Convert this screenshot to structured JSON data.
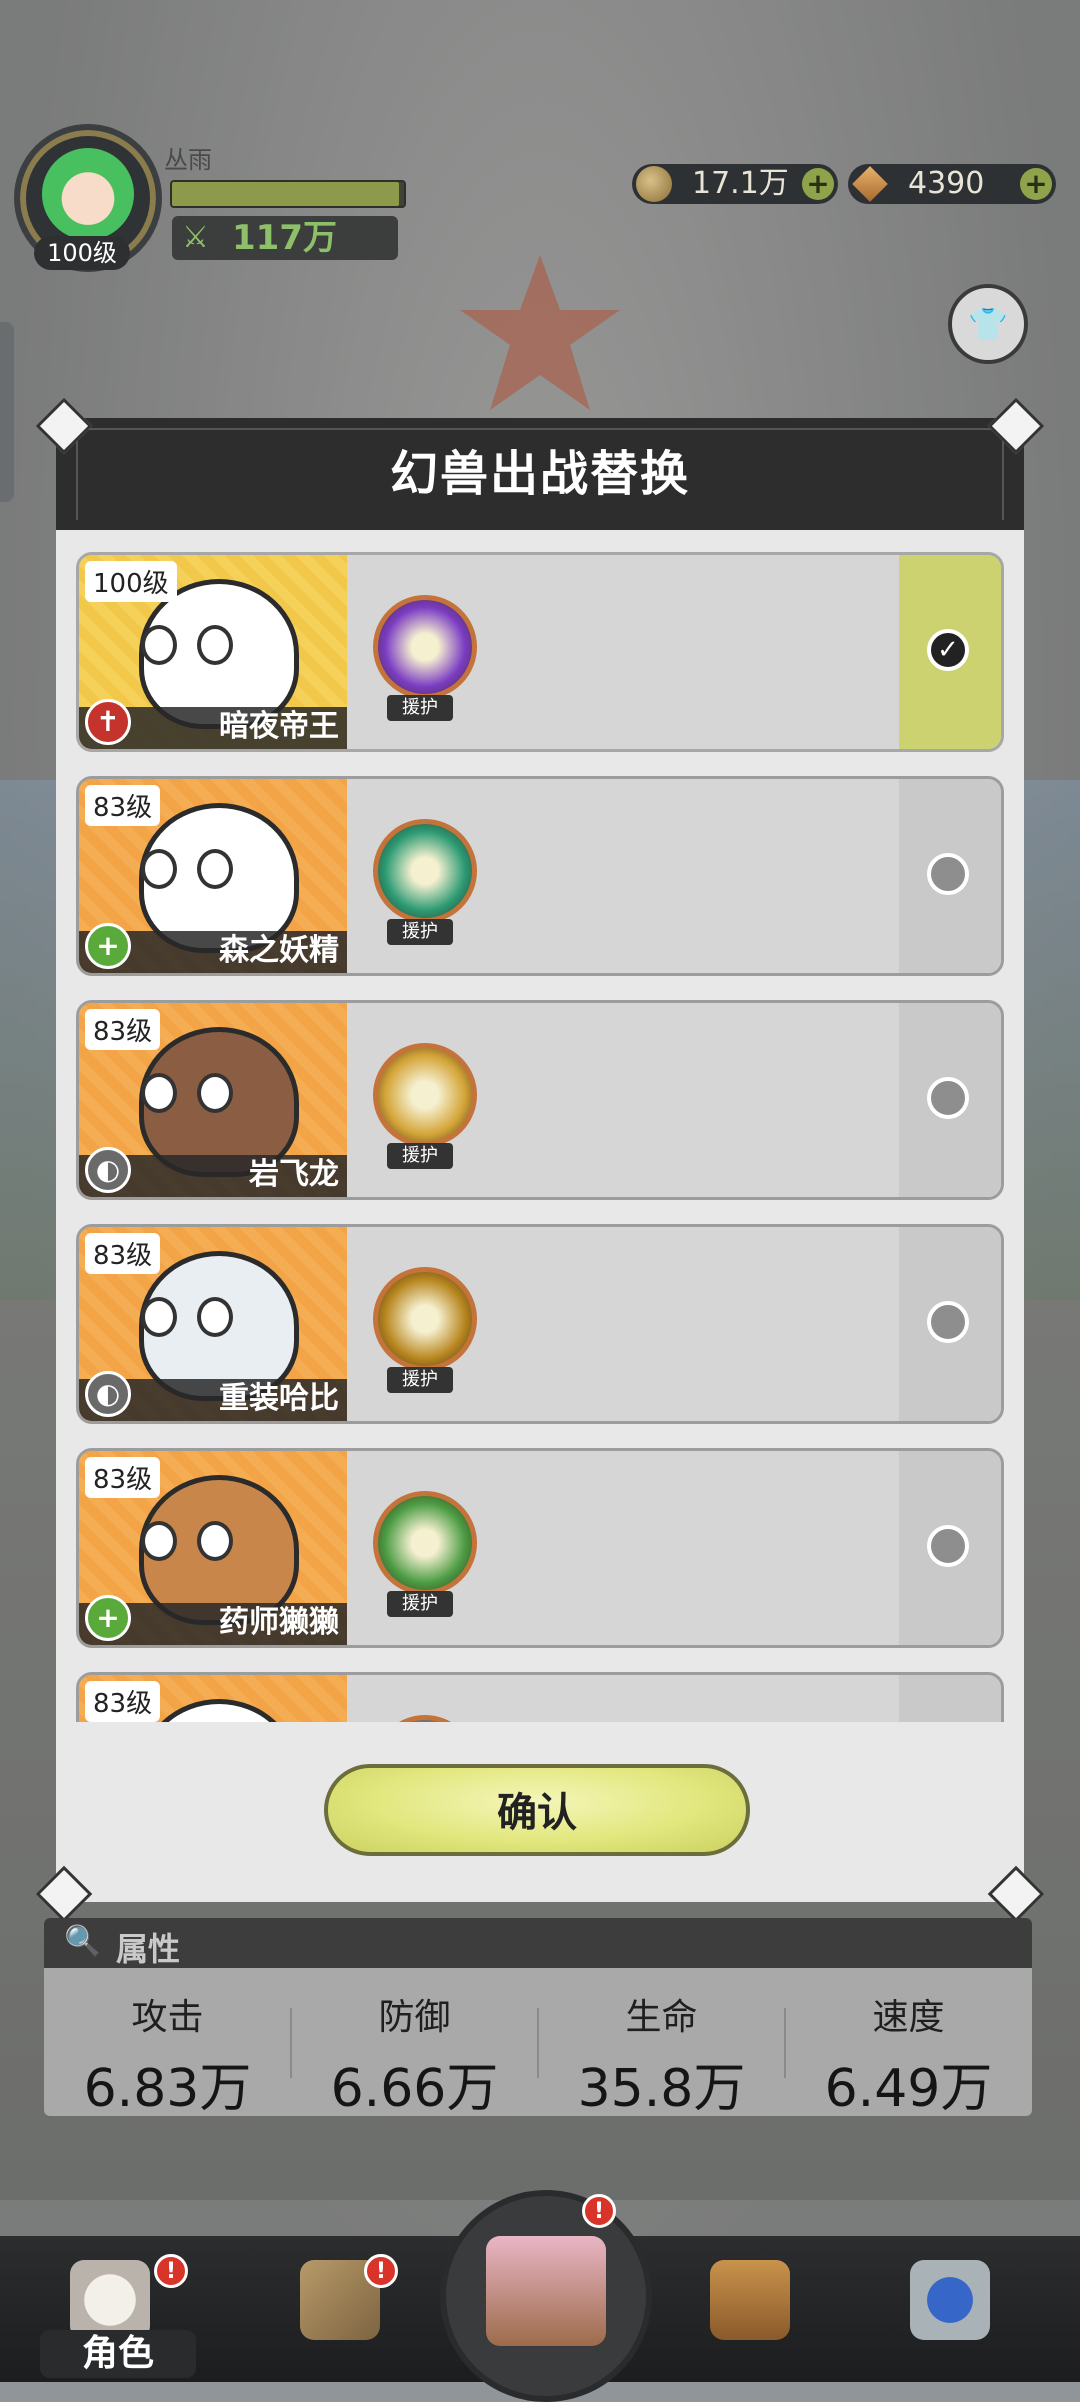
{
  "player": {
    "name": "丛雨",
    "level": "100级",
    "xp_fraction": 0.98,
    "power": "117万"
  },
  "currencies": {
    "coins": "17.1万",
    "gems": "4390",
    "plus": "+"
  },
  "dialog": {
    "title": "幻兽出战替换",
    "confirm_label": "确认",
    "skill_tag": "援护",
    "pets": [
      {
        "level": "100级",
        "name": "暗夜帝王",
        "role": "attack",
        "selected": true,
        "portrait_color": "gold",
        "body_color": "#ffffff",
        "skill_color": "#7b3cc3"
      },
      {
        "level": "83级",
        "name": "森之妖精",
        "role": "heal",
        "selected": false,
        "portrait_color": "orange",
        "body_color": "#ffffff",
        "skill_color": "#2b9a73"
      },
      {
        "level": "83级",
        "name": "岩飞龙",
        "role": "defense",
        "selected": false,
        "portrait_color": "orange",
        "body_color": "#8b5e43",
        "skill_color": "#d4a437"
      },
      {
        "level": "83级",
        "name": "重装哈比",
        "role": "defense",
        "selected": false,
        "portrait_color": "orange",
        "body_color": "#e9eef3",
        "skill_color": "#b8861f"
      },
      {
        "level": "83级",
        "name": "药师獭獭",
        "role": "heal",
        "selected": false,
        "portrait_color": "orange",
        "body_color": "#c8864a",
        "skill_color": "#4c9c44"
      },
      {
        "level": "83级",
        "name": "",
        "role": "heal",
        "selected": false,
        "portrait_color": "orange",
        "body_color": "#ffffff",
        "skill_color": "#888888"
      }
    ]
  },
  "attributes": {
    "title": "属性",
    "stats": [
      {
        "label": "攻击",
        "value": "6.83万"
      },
      {
        "label": "防御",
        "value": "6.66万"
      },
      {
        "label": "生命",
        "value": "35.8万"
      },
      {
        "label": "速度",
        "value": "6.49万"
      }
    ]
  },
  "nav": {
    "active_label": "角色",
    "badge": "!"
  },
  "colors": {
    "accent_green": "#ccd26f",
    "dialog_header": "#2d2d2d",
    "badge_red": "#d8342a"
  }
}
